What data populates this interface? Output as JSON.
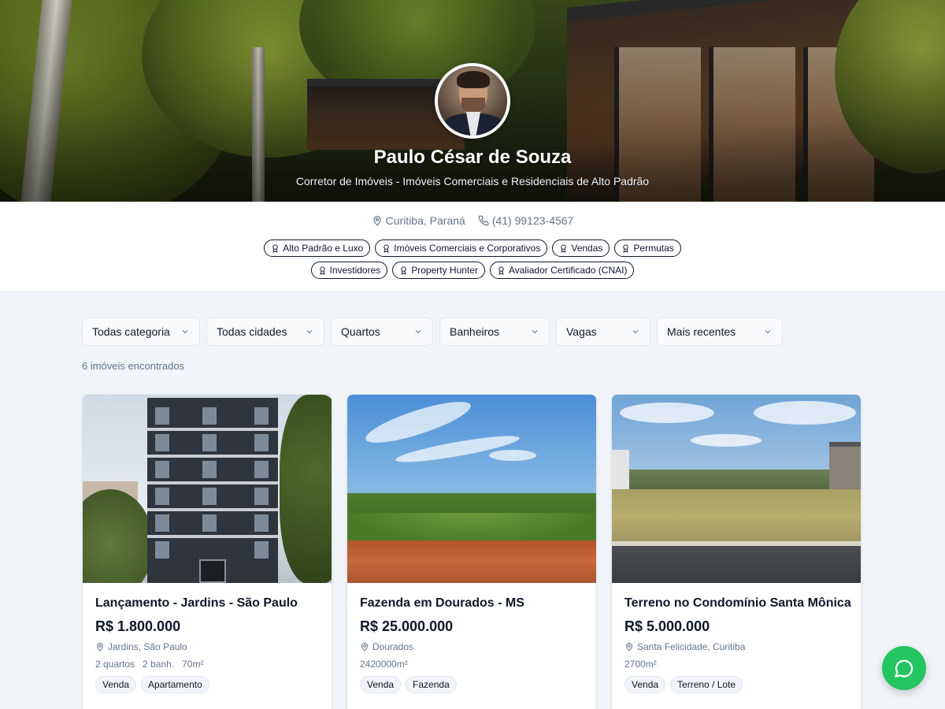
{
  "profile": {
    "name": "Paulo César de Souza",
    "subtitle": "Corretor de Imóveis - Imóveis Comerciais e Residenciais de Alto Padrão",
    "location": "Curitiba, Paraná",
    "phone": "(41) 99123-4567",
    "specialties_row1": [
      "Alto Padrão e Luxo",
      "Imóveis Comerciais e Corporativos",
      "Vendas",
      "Permutas"
    ],
    "specialties_row2": [
      "Investidores",
      "Property Hunter",
      "Avaliador Certificado (CNAI)"
    ]
  },
  "filters": [
    {
      "label": "Todas categoria"
    },
    {
      "label": "Todas cidades"
    },
    {
      "label": "Quartos"
    },
    {
      "label": "Banheiros"
    },
    {
      "label": "Vagas"
    },
    {
      "label": "Mais recentes"
    }
  ],
  "results_count": "6 imóveis encontrados",
  "listings": [
    {
      "title": "Lançamento - Jardins - São Paulo",
      "price": "R$ 1.800.000",
      "location": "Jardins, São Paulo",
      "features": [
        "2 quartos",
        "2 banh.",
        "70m²"
      ],
      "tags": [
        "Venda",
        "Apartamento"
      ]
    },
    {
      "title": "Fazenda em Dourados - MS",
      "price": "R$ 25.000.000",
      "location": "Dourados",
      "features": [
        "2420000m²"
      ],
      "tags": [
        "Venda",
        "Fazenda"
      ]
    },
    {
      "title": "Terreno no Condomínio Santa Mônica",
      "price": "R$ 5.000.000",
      "location": "Santa Felicidade, Curitiba",
      "features": [
        "2700m²"
      ],
      "tags": [
        "Venda",
        "Terreno / Lote"
      ]
    }
  ],
  "colors": {
    "whatsapp": "#22c55e",
    "page_bg": "#f1f5f9",
    "text": "#0f172a",
    "muted": "#64748b"
  },
  "icons": {
    "location": "map-pin-icon",
    "phone": "phone-icon",
    "tag": "award-icon",
    "dropdown": "chevron-down-icon",
    "chat": "whatsapp-icon"
  }
}
